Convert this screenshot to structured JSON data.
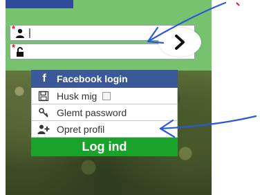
{
  "login": {
    "username_value": "|",
    "required_mark": "*",
    "facebook_label": "Facebook login",
    "remember_label": "Husk mig",
    "forgot_label": "Glemt password",
    "create_label": "Opret profil",
    "login_button": "Log ind"
  },
  "icons": [
    "user-icon",
    "lock-icon",
    "chevron-right-icon",
    "facebook-icon",
    "save-icon",
    "key-icon",
    "add-user-icon"
  ],
  "colors": {
    "facebook": "#3b5998",
    "login_green": "#1aa32a",
    "required_red": "#e0191f",
    "annotation_blue": "#2a59d6"
  }
}
